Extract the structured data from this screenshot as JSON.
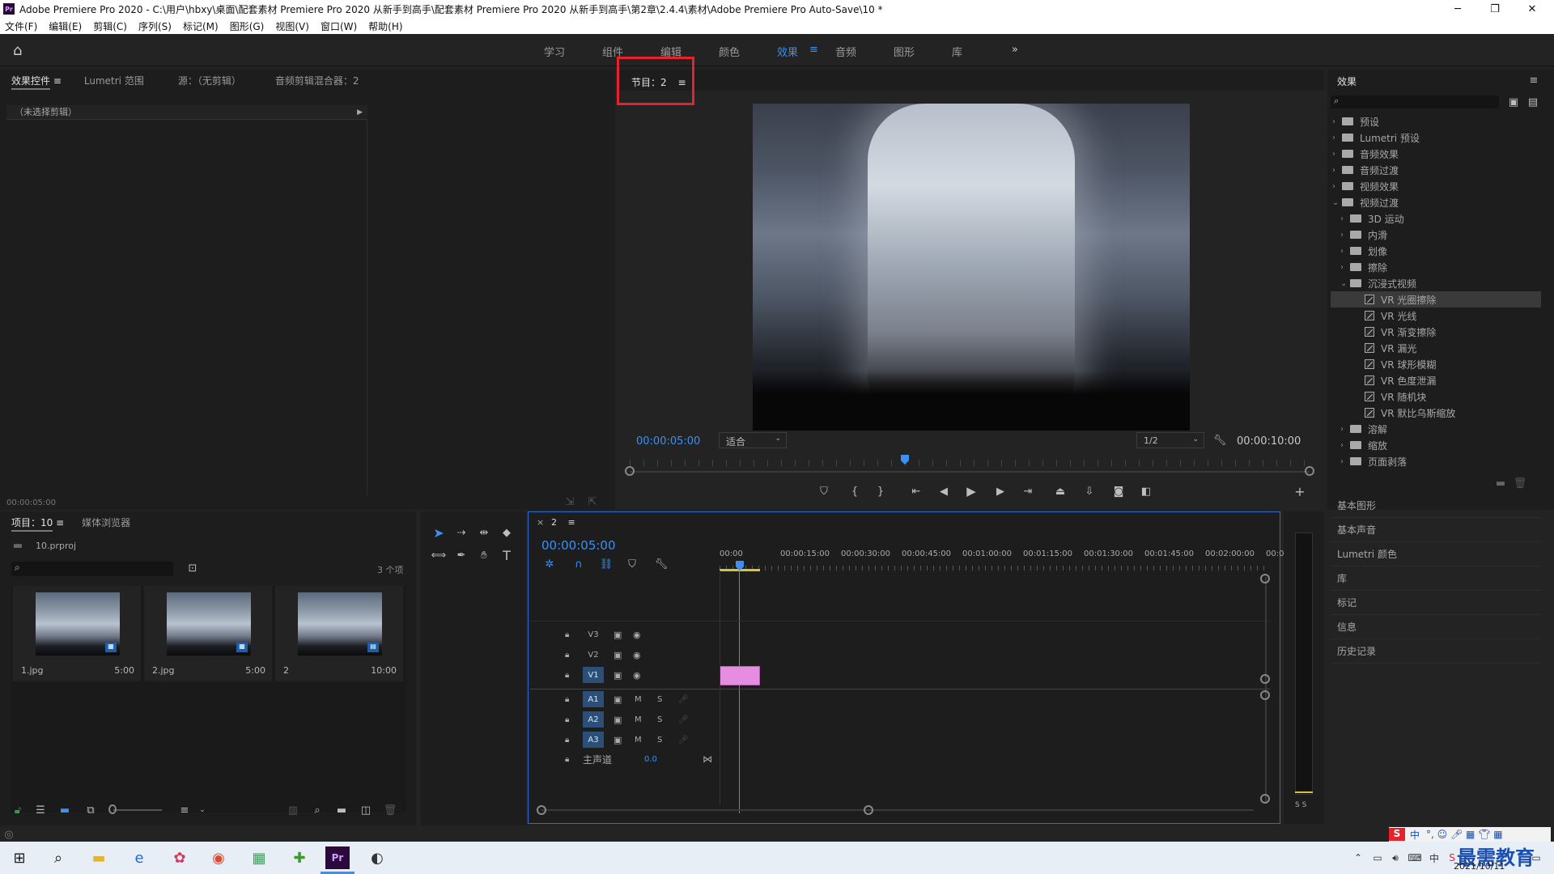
{
  "window": {
    "title": "Adobe Premiere Pro 2020 - C:\\用户\\hbxy\\桌面\\配套素材 Premiere Pro 2020 从新手到高手\\配套素材 Premiere Pro 2020 从新手到高手\\第2章\\2.4.4\\素材\\Adobe Premiere Pro Auto-Save\\10 *",
    "app_badge": "Pr"
  },
  "menu": [
    "文件(F)",
    "编辑(E)",
    "剪辑(C)",
    "序列(S)",
    "标记(M)",
    "图形(G)",
    "视图(V)",
    "窗口(W)",
    "帮助(H)"
  ],
  "workspaces": [
    {
      "label": "学习",
      "active": false
    },
    {
      "label": "组件",
      "active": false
    },
    {
      "label": "编辑",
      "active": false
    },
    {
      "label": "颜色",
      "active": false
    },
    {
      "label": "效果",
      "active": true
    },
    {
      "label": "音频",
      "active": false
    },
    {
      "label": "图形",
      "active": false
    },
    {
      "label": "库",
      "active": false
    }
  ],
  "workspace_more": "»",
  "source_panel": {
    "tabs": [
      "效果控件",
      "Lumetri 范围",
      "源：（无剪辑）",
      "音频剪辑混合器：2"
    ],
    "no_clip": "（未选择剪辑）",
    "timecode": "00:00:05:00"
  },
  "program": {
    "tab": "节目：2",
    "timecode": "00:00:05:00",
    "fit": "适合",
    "resolution": "1/2",
    "duration": "00:00:10:00",
    "playhead_fraction": 0.5
  },
  "effects_panel": {
    "title": "效果",
    "tree": [
      {
        "label": "预设",
        "level": 0,
        "type": "folder-star",
        "open": false
      },
      {
        "label": "Lumetri 预设",
        "level": 0,
        "type": "folder-star",
        "open": false
      },
      {
        "label": "音频效果",
        "level": 0,
        "type": "folder",
        "open": false
      },
      {
        "label": "音频过渡",
        "level": 0,
        "type": "folder",
        "open": false
      },
      {
        "label": "视频效果",
        "level": 0,
        "type": "folder",
        "open": false
      },
      {
        "label": "视频过渡",
        "level": 0,
        "type": "folder",
        "open": true
      },
      {
        "label": "3D 运动",
        "level": 1,
        "type": "folder",
        "open": false
      },
      {
        "label": "内滑",
        "level": 1,
        "type": "folder",
        "open": false
      },
      {
        "label": "划像",
        "level": 1,
        "type": "folder",
        "open": false
      },
      {
        "label": "擦除",
        "level": 1,
        "type": "folder",
        "open": false
      },
      {
        "label": "沉浸式视频",
        "level": 1,
        "type": "folder",
        "open": true
      },
      {
        "label": "VR 光圈擦除",
        "level": 2,
        "type": "fx",
        "selected": true
      },
      {
        "label": "VR 光线",
        "level": 2,
        "type": "fx"
      },
      {
        "label": "VR 渐变擦除",
        "level": 2,
        "type": "fx"
      },
      {
        "label": "VR 漏光",
        "level": 2,
        "type": "fx"
      },
      {
        "label": "VR 球形模糊",
        "level": 2,
        "type": "fx"
      },
      {
        "label": "VR 色度泄漏",
        "level": 2,
        "type": "fx"
      },
      {
        "label": "VR 随机块",
        "level": 2,
        "type": "fx"
      },
      {
        "label": "VR 默比乌斯缩放",
        "level": 2,
        "type": "fx"
      },
      {
        "label": "溶解",
        "level": 1,
        "type": "folder",
        "open": false
      },
      {
        "label": "缩放",
        "level": 1,
        "type": "folder",
        "open": false
      },
      {
        "label": "页面剥落",
        "level": 1,
        "type": "folder",
        "open": false
      }
    ],
    "panels": [
      "基本图形",
      "基本声音",
      "Lumetri 颜色",
      "库",
      "标记",
      "信息",
      "历史记录"
    ]
  },
  "project": {
    "tabs": [
      "项目：10",
      "媒体浏览器"
    ],
    "file": "10.prproj",
    "count": "3 个项",
    "items": [
      {
        "name": "1.jpg",
        "duration": "5:00"
      },
      {
        "name": "2.jpg",
        "duration": "5:00"
      },
      {
        "name": "2",
        "duration": "10:00"
      }
    ]
  },
  "timeline": {
    "tab": "2",
    "timecode": "00:00:05:00",
    "ruler": [
      "00:00",
      "00:00:15:00",
      "00:00:30:00",
      "00:00:45:00",
      "00:01:00:00",
      "00:01:15:00",
      "00:01:30:00",
      "00:01:45:00",
      "00:02:00:00",
      "00:0"
    ],
    "video_tracks": [
      "V3",
      "V2",
      "V1"
    ],
    "audio_tracks": [
      "A1",
      "A2",
      "A3"
    ],
    "master": {
      "label": "主声道",
      "value": "0.0"
    },
    "ms": [
      "M",
      "S"
    ],
    "meter_labels": "S S"
  },
  "taskbar": {
    "watermark": "最需教育",
    "date": "2021/10/11",
    "ime": "中"
  },
  "colors": {
    "accent": "#3d8ff0",
    "highlight_box": "#e8222a",
    "clip": "#e58de0"
  }
}
